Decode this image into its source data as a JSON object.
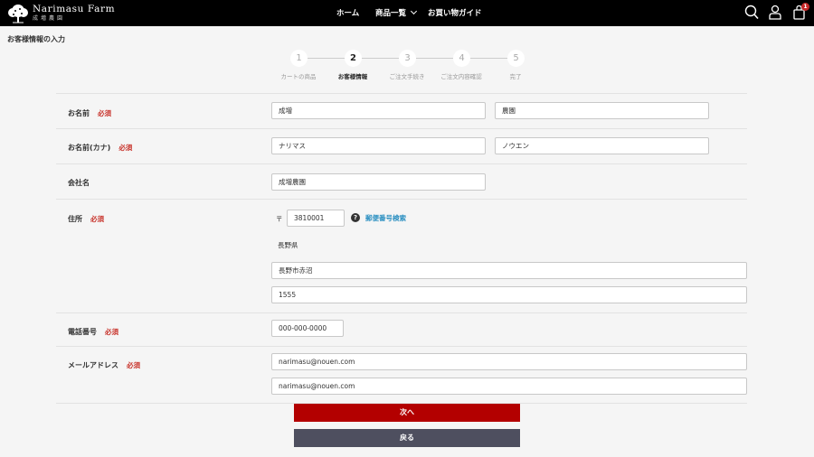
{
  "header": {
    "logo_en": "Narimasu Farm",
    "logo_jp": "成増農園",
    "nav": [
      {
        "label": "ホーム"
      },
      {
        "label": "商品一覧"
      },
      {
        "label": "お買い物ガイド"
      }
    ],
    "cart_count": "1",
    "icons": [
      "search-icon",
      "user-icon",
      "cart-icon"
    ]
  },
  "page_title": "お客様情報の入力",
  "steps": [
    {
      "num": "1",
      "label": "カートの商品",
      "active": false
    },
    {
      "num": "2",
      "label": "お客様情報",
      "active": true
    },
    {
      "num": "3",
      "label": "ご注文手続き",
      "active": false
    },
    {
      "num": "4",
      "label": "ご注文内容確認",
      "active": false
    },
    {
      "num": "5",
      "label": "完了",
      "active": false
    }
  ],
  "form": {
    "required_label": "必須",
    "name": {
      "label": "お名前",
      "last": "成増",
      "first": "農園"
    },
    "kana": {
      "label": "お名前(カナ)",
      "last": "ナリマス",
      "first": "ノウエン"
    },
    "company": {
      "label": "会社名",
      "value": "成増農園"
    },
    "address": {
      "label": "住所",
      "postal_mark": "〒",
      "postal": "3810001",
      "lookup_link": "郵便番号検索",
      "prefecture": "長野県",
      "city": "長野市赤沼",
      "line": "1555"
    },
    "phone": {
      "label": "電話番号",
      "value": "000-000-0000"
    },
    "email": {
      "label": "メールアドレス",
      "value": "narimasu@nouen.com",
      "confirm": "narimasu@nouen.com"
    }
  },
  "buttons": {
    "next": "次へ",
    "back": "戻る"
  },
  "colors": {
    "header_bg": "#000000",
    "required": "#c8332b",
    "link": "#2a8fc1",
    "next_button": "#b30000",
    "back_button": "#4e4f5f"
  }
}
